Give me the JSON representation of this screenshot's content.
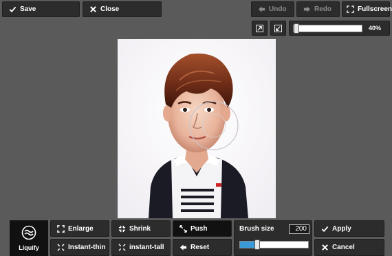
{
  "topbar": {
    "save_label": "Save",
    "close_label": "Close",
    "undo_label": "Undo",
    "redo_label": "Redo",
    "fullscreen_label": "Fullscreen"
  },
  "zoom": {
    "fraction": 0.4,
    "label": "40%"
  },
  "canvas": {
    "content": "caricature-portrait-image"
  },
  "tools": {
    "liquify_label": "Liquify",
    "enlarge_label": "Enlarge",
    "shrink_label": "Shrink",
    "push_label": "Push",
    "instant_thin_label": "Instant-thin",
    "instant_tall_label": "instant-tall",
    "reset_label": "Reset",
    "active_tool": "Push"
  },
  "brush": {
    "label": "Brush size",
    "value": "200",
    "fraction": 0.25
  },
  "actions": {
    "apply_label": "Apply",
    "cancel_label": "Cancel"
  },
  "colors": {
    "background": "#5a5a5a",
    "button": "#2c2c2c",
    "active": "#111111",
    "accent": "#3a9ad9"
  }
}
